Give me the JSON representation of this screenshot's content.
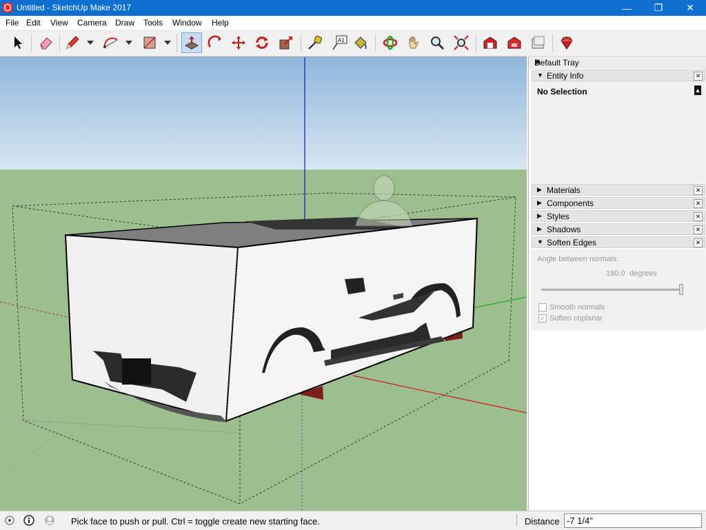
{
  "window": {
    "title": "Untitled - SketchUp Make 2017"
  },
  "menu": [
    "File",
    "Edit",
    "View",
    "Camera",
    "Draw",
    "Tools",
    "Window",
    "Help"
  ],
  "toolbar": {
    "tools": [
      "select-tool",
      "eraser-tool",
      "pencil-tool",
      "arc-tool",
      "rectangle-tool",
      "push-pull-tool",
      "follow-me-tool",
      "move-tool",
      "rotate-tool",
      "scale-tool",
      "tape-measure-tool",
      "text-tool",
      "paint-bucket-tool",
      "orbit-tool",
      "pan-tool",
      "zoom-tool",
      "zoom-extents-tool",
      "warehouse-tool",
      "extension-warehouse-tool",
      "layout-tool",
      "ruby-tool"
    ],
    "active_tool": "push-pull-tool",
    "text_tool_label": "A1"
  },
  "tray": {
    "title": "Default Tray",
    "entity_info": {
      "label": "Entity Info",
      "value": "No Selection"
    },
    "panels": [
      "Materials",
      "Components",
      "Styles",
      "Shadows",
      "Soften Edges"
    ],
    "soften": {
      "angle_label": "Angle between normals:",
      "angle_value": "180.0",
      "angle_unit": "degrees",
      "slider_value": 1.0,
      "smooth_label": "Smooth normals",
      "smooth_checked": false,
      "coplanar_label": "Soften coplanar",
      "coplanar_checked": true
    }
  },
  "status": {
    "message": "Pick face to push or pull.  Ctrl = toggle create new starting face.",
    "measure_label": "Distance",
    "measure_value": "-7 1/4\""
  },
  "colors": {
    "sky": "#a9c7e2",
    "ground": "#9dbe8e",
    "axis_red": "#d01818",
    "axis_green": "#22aa22",
    "axis_blue": "#1010cc",
    "titlebar": "#0f6fd0"
  }
}
